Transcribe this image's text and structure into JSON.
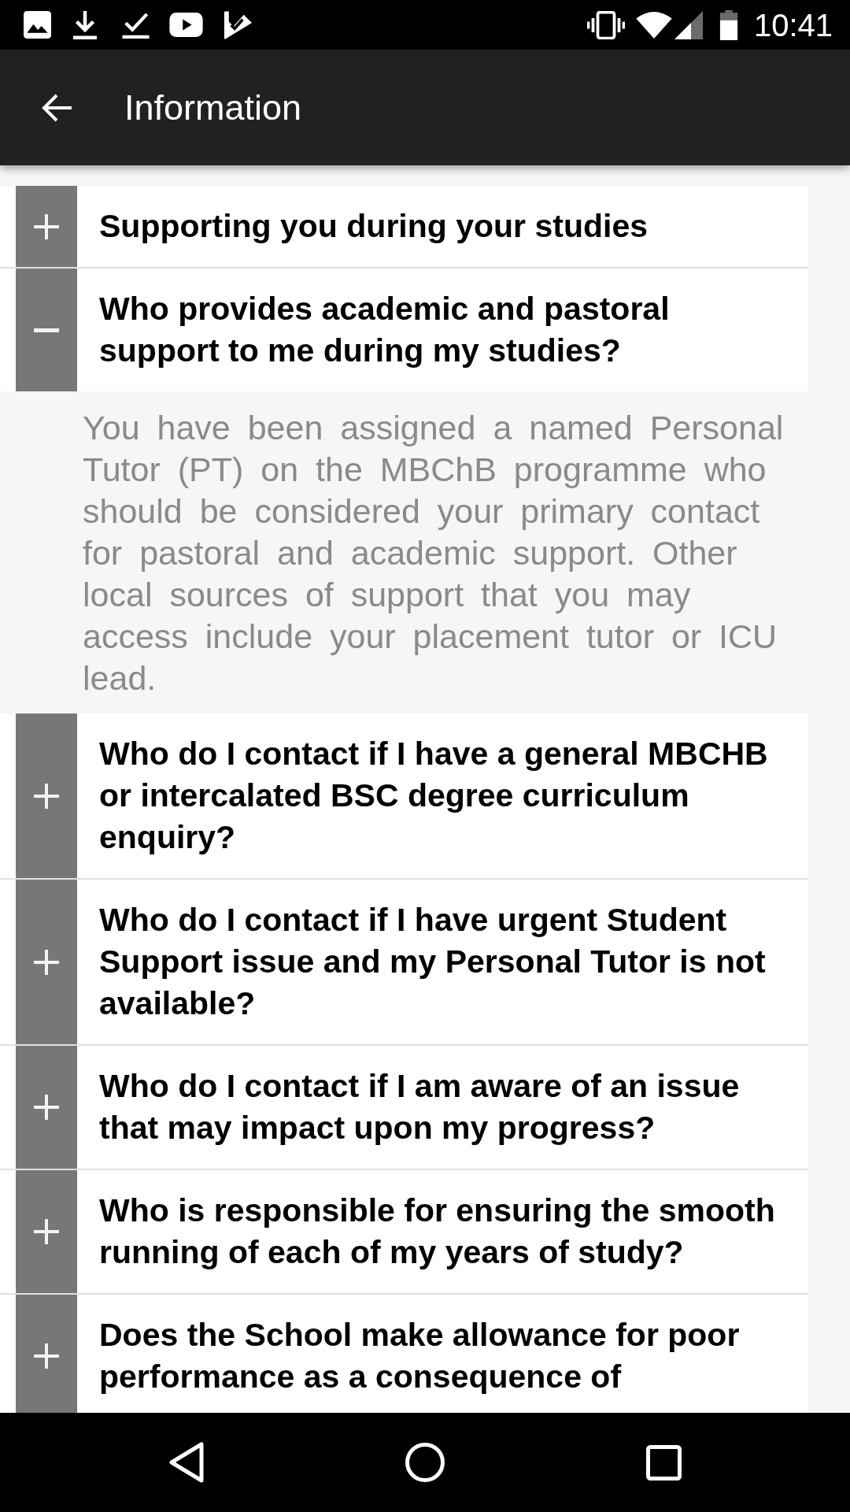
{
  "status_bar": {
    "time": "10:41"
  },
  "app_bar": {
    "title": "Information"
  },
  "items": [
    {
      "question": "Supporting you during your studies",
      "expanded": false
    },
    {
      "question": "Who provides academic and pastoral support to me during my studies?",
      "expanded": true,
      "answer": "You have been assigned a named Personal Tutor (PT) on the MBChB programme who should be considered your primary contact for pastoral and academic support. Other local sources of support that you may access include your placement tutor or ICU lead."
    },
    {
      "question": "Who do I contact if I have a general MBCHB or intercalated BSC degree curriculum enquiry?",
      "expanded": false
    },
    {
      "question": "Who do I contact if I have urgent Student Support issue and my Personal Tutor is not available?",
      "expanded": false
    },
    {
      "question": "Who do I contact if I am aware of an issue that may impact upon my progress?",
      "expanded": false
    },
    {
      "question": "Who is responsible for ensuring the smooth running of each of my years of study?",
      "expanded": false
    },
    {
      "question": "Does the School make allowance for poor performance as a consequence of",
      "expanded": false
    }
  ]
}
